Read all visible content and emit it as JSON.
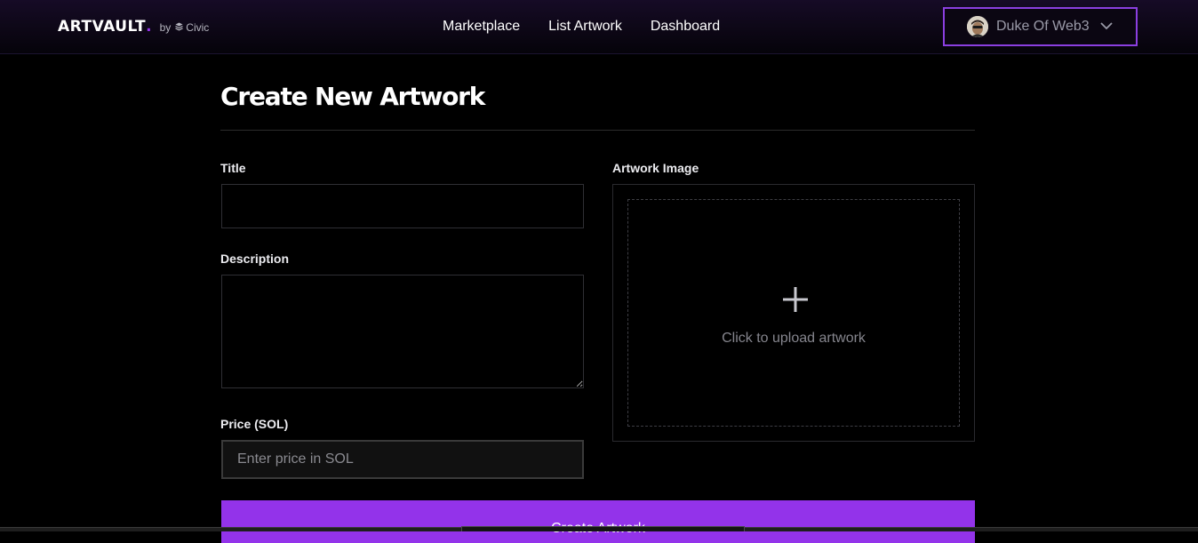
{
  "header": {
    "brand": "ARTVAULT",
    "brand_dot": ".",
    "by": "by",
    "partner": "Civic",
    "nav": [
      {
        "label": "Marketplace"
      },
      {
        "label": "List Artwork"
      },
      {
        "label": "Dashboard"
      }
    ],
    "user": {
      "name": "Duke Of Web3"
    }
  },
  "form": {
    "title": "Create New Artwork",
    "title_label": "Title",
    "title_value": "",
    "description_label": "Description",
    "description_value": "",
    "price_label": "Price (SOL)",
    "price_placeholder": "Enter price in SOL",
    "image_label": "Artwork Image",
    "upload_text": "Click to upload artwork",
    "submit_label": "Create Artwork"
  },
  "colors": {
    "accent": "#9333ea",
    "background": "#000000",
    "border": "#2f2f34"
  },
  "icons": {
    "partner": "civic-logo-icon",
    "user_menu": "chevron-down-icon",
    "upload": "plus-icon"
  }
}
